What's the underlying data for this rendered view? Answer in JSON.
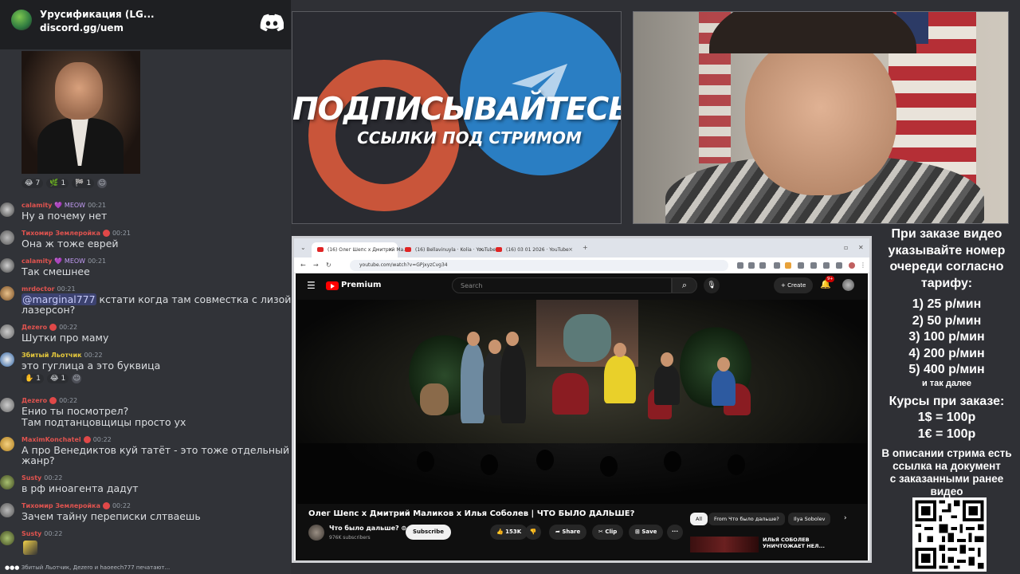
{
  "discord": {
    "server_name": "Урусификация (LG...",
    "server_link": "discord.gg/uem",
    "gif_reactions": [
      {
        "emoji": "😂",
        "count": "7"
      },
      {
        "emoji": "🌿",
        "count": "1"
      },
      {
        "emoji": "🏁",
        "count": "1"
      }
    ],
    "messages": [
      {
        "user": "calamity",
        "tag": "💜 MEOW",
        "time": "00:21",
        "text": "Ну а почему нет",
        "color": "#e0534f"
      },
      {
        "user": "Тихомир Землеройка",
        "tag": "",
        "time": "00:21",
        "text": "Она ж тоже еврей",
        "color": "#e0534f"
      },
      {
        "user": "calamity",
        "tag": "💜 MEOW",
        "time": "00:21",
        "text": "Так смешнее",
        "color": "#e0534f"
      },
      {
        "user": "mrdoctor",
        "tag": "",
        "time": "00:21",
        "mention": "@marginal777",
        "text": " кстати когда там совместка с лизой",
        "text2": "лазерсон?",
        "color": "#e0534f"
      },
      {
        "user": "Дezero",
        "tag": "",
        "time": "00:22",
        "text": "Шутки про маму",
        "color": "#e0534f"
      },
      {
        "user": "Збитый Льотчик",
        "tag": "",
        "time": "00:22",
        "text": "это гуглица а это буквица",
        "color": "#e6c93c"
      },
      {
        "user": "Дezero",
        "tag": "",
        "time": "00:22",
        "text": "Енио ты посмотрел?",
        "text2": "Там подтанцовщицы просто ух",
        "color": "#e0534f"
      },
      {
        "user": "MaximKonchatel",
        "tag": "",
        "time": "00:22",
        "text": "А про Венедиктов куй татёт - это тоже отдельный",
        "text2": "жанр?",
        "color": "#e0534f"
      },
      {
        "user": "Susty",
        "tag": "",
        "time": "00:22",
        "text": "в рф иноагента дадут",
        "color": "#e0534f"
      },
      {
        "user": "Тихомир Землеройка",
        "tag": "",
        "time": "00:22",
        "text": "Зачем тайну переписки слтваешь",
        "color": "#e0534f"
      },
      {
        "user": "Susty",
        "tag": "",
        "time": "00:22",
        "text": "",
        "color": "#e0534f"
      }
    ],
    "msg_reactions": [
      {
        "emoji": "✋",
        "count": "1"
      },
      {
        "emoji": "😂",
        "count": "1"
      }
    ],
    "typing": "Збитый Льотчик, Дezero и haoeech777 печатают..."
  },
  "banner": {
    "title": "ПОДПИСЫВАЙТЕСЬ",
    "subtitle": "ССЫЛКИ ПОД СТРИМОМ"
  },
  "browser": {
    "tabs": [
      "(16) Олег Шепс x Дмитрий Ма...",
      "(16) Bellavinuyla · Kolia · YouTube",
      "(16) 03 01 2026 · YouTube"
    ],
    "url": "youtube.com/watch?v=GPjxyzCvg34"
  },
  "youtube": {
    "brand": "Premium",
    "search_placeholder": "Search",
    "create_label": "+ Create",
    "notif_count": "9+",
    "video_title": "Олег Шепс х Дмитрий Маликов х Илья Соболев | ЧТО БЫЛО ДАЛЬШЕ?",
    "channel": "Что было дальше? ⊙",
    "subscribers": "976K subscribers",
    "subscribe": "Subscribe",
    "likes": "153K",
    "share": "Share",
    "clip": "Clip",
    "save": "Save",
    "more": "···",
    "chips": [
      "All",
      "From Что было дальше?",
      "Ilya Sobolev"
    ],
    "rec_title": "ИЛЬЯ СОБОЛЕВ УНИЧТОЖАЕТ НЕЛ..."
  },
  "info": {
    "order_text": [
      "При заказе видео",
      "указывайте номер",
      "очереди согласно",
      "тарифу:"
    ],
    "tariffs": [
      "1) 25 р/мин",
      "2) 50 р/мин",
      "3) 100 р/мин",
      "4) 200 р/мин",
      "5) 400 р/мин"
    ],
    "and_more": "и так далее",
    "rates_title": "Курсы при заказе:",
    "rates": [
      "1$ = 100р",
      "1€ = 100р"
    ],
    "desc_text": [
      "В описании стрима есть",
      "ссылка на документ",
      "с заказанными ранее",
      "видео"
    ]
  }
}
